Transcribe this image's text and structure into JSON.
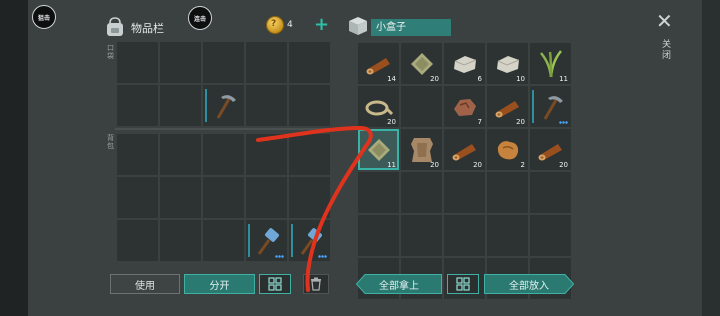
{
  "hud": {
    "attack_label": "狙击",
    "combo_label": "连击"
  },
  "inventory": {
    "title": "物品栏",
    "hotbar_label": "口袋",
    "backpack_label": "背包",
    "coins": "4"
  },
  "container": {
    "title": "小盒子",
    "close_label": "关闭"
  },
  "hotbar_slots": [
    {
      "item": "",
      "qty": ""
    },
    {
      "item": "",
      "qty": ""
    },
    {
      "item": "",
      "qty": ""
    },
    {
      "item": "",
      "qty": ""
    },
    {
      "item": "",
      "qty": ""
    },
    {
      "item": "",
      "qty": ""
    },
    {
      "item": "",
      "qty": ""
    },
    {
      "item": "pickaxe",
      "qty": ""
    },
    {
      "item": "",
      "qty": ""
    },
    {
      "item": "",
      "qty": ""
    }
  ],
  "backpack_slots": [
    {
      "item": "",
      "qty": ""
    },
    {
      "item": "",
      "qty": ""
    },
    {
      "item": "",
      "qty": ""
    },
    {
      "item": "",
      "qty": ""
    },
    {
      "item": "",
      "qty": ""
    },
    {
      "item": "",
      "qty": ""
    },
    {
      "item": "",
      "qty": ""
    },
    {
      "item": "",
      "qty": ""
    },
    {
      "item": "",
      "qty": ""
    },
    {
      "item": "",
      "qty": ""
    },
    {
      "item": "",
      "qty": ""
    },
    {
      "item": "",
      "qty": ""
    },
    {
      "item": "",
      "qty": ""
    },
    {
      "item": "hammer",
      "qty": ""
    },
    {
      "item": "hammer",
      "qty": ""
    }
  ],
  "container_slots": [
    {
      "item": "log",
      "qty": "14"
    },
    {
      "item": "cloth",
      "qty": "20"
    },
    {
      "item": "stone",
      "qty": "6"
    },
    {
      "item": "stone",
      "qty": "10"
    },
    {
      "item": "plant",
      "qty": "11"
    },
    {
      "item": "rope",
      "qty": "20"
    },
    {
      "item": "",
      "qty": ""
    },
    {
      "item": "ore",
      "qty": "7"
    },
    {
      "item": "log",
      "qty": "20"
    },
    {
      "item": "pickaxe",
      "qty": ""
    },
    {
      "item": "cloth",
      "qty": "11"
    },
    {
      "item": "hide",
      "qty": "20"
    },
    {
      "item": "log",
      "qty": "20"
    },
    {
      "item": "leather",
      "qty": "2"
    },
    {
      "item": "log",
      "qty": "20"
    },
    {
      "item": "",
      "qty": ""
    },
    {
      "item": "",
      "qty": ""
    },
    {
      "item": "",
      "qty": ""
    },
    {
      "item": "",
      "qty": ""
    },
    {
      "item": "",
      "qty": ""
    },
    {
      "item": "",
      "qty": ""
    },
    {
      "item": "",
      "qty": ""
    },
    {
      "item": "",
      "qty": ""
    },
    {
      "item": "",
      "qty": ""
    },
    {
      "item": "",
      "qty": ""
    },
    {
      "item": "",
      "qty": ""
    },
    {
      "item": "",
      "qty": ""
    },
    {
      "item": "",
      "qty": ""
    },
    {
      "item": "",
      "qty": ""
    },
    {
      "item": "",
      "qty": ""
    }
  ],
  "selected_container_slot": 10,
  "buttons": {
    "use": "使用",
    "split": "分开",
    "take_all": "全部拿上",
    "put_all": "全部放入"
  },
  "colors": {
    "accent": "#2f7f78",
    "accent_border": "#3eb1a4",
    "annotation_stroke": "#e0331d"
  }
}
